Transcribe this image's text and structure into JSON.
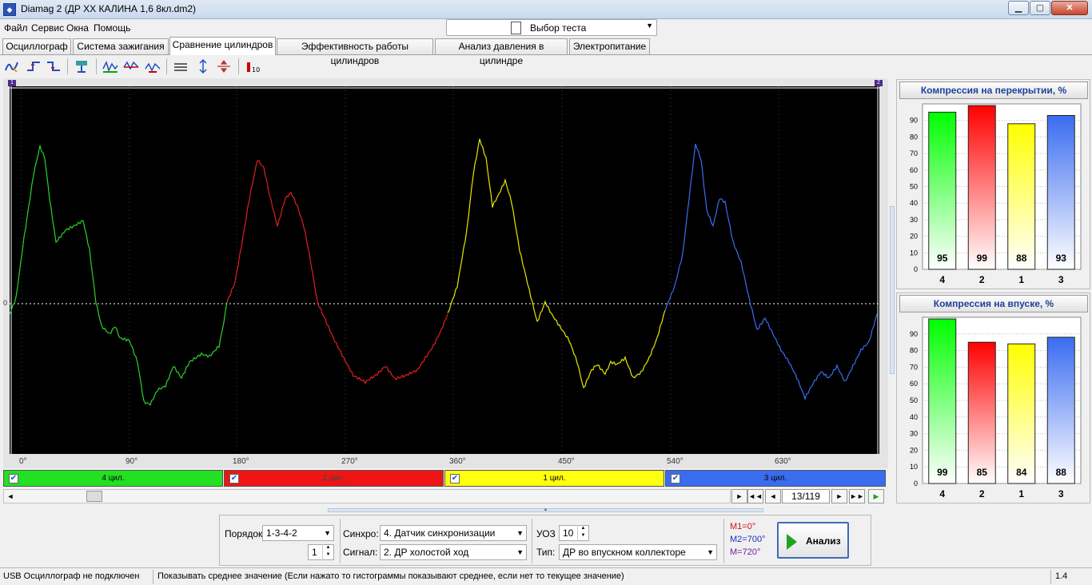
{
  "window": {
    "title": "Diamag 2 (ДР ХХ КАЛИНА 1,6 8кл.dm2)",
    "minimize": "▁",
    "maximize": "▢",
    "close": "✕"
  },
  "menu": [
    "Файл",
    "Сервис",
    "Окна",
    "Помощь"
  ],
  "test_select": {
    "label": "Выбор теста",
    "icon": "document-gear-icon"
  },
  "tabs": [
    {
      "label": "Осциллограф",
      "active": false
    },
    {
      "label": "Система зажигания",
      "active": false
    },
    {
      "label": "Сравнение цилиндров",
      "active": true
    },
    {
      "label": "Эффективность работы цилиндров",
      "active": false
    },
    {
      "label": "Анализ давления в цилиндре",
      "active": false
    },
    {
      "label": "Электропитание",
      "active": false
    }
  ],
  "toolbar": {
    "icons": [
      "cursor-wave-icon",
      "rising-edge-icon",
      "falling-edge-icon",
      "signal-probe-icon",
      "cylinder-split-icon",
      "cylinder-overlay-icon",
      "cylinder-shift-icon",
      "horizontal-lines-icon",
      "vertical-scale-icon",
      "center-icon",
      "bar-chart-icon"
    ]
  },
  "scope": {
    "marker_left": "1",
    "marker_right": "2",
    "zero_label": "0",
    "degree_labels": [
      "0°",
      "90°",
      "180°",
      "270°",
      "360°",
      "450°",
      "540°",
      "630°"
    ],
    "colors": {
      "background": "#000000",
      "grid": "#3c3c3c",
      "baseline": "#ffffff"
    }
  },
  "cylinders": [
    {
      "label": "4 цил.",
      "color": "#00ff00",
      "checked": true
    },
    {
      "label": "2 цил.",
      "color": "#ff0000",
      "checked": true
    },
    {
      "label": "1 цил.",
      "color": "#ffff00",
      "checked": true
    },
    {
      "label": "3 цил.",
      "color": "#3a6cf0",
      "checked": true
    }
  ],
  "navigation": {
    "counter": "13/119",
    "scroll_left": "◄",
    "scroll_right": "►",
    "first": "◄◄",
    "prev": "◄",
    "next": "►",
    "last": "►►",
    "play": "▶",
    "step": "►"
  },
  "charts": [
    {
      "title": "Компрессия на перекрытии, %",
      "ylim": [
        0,
        100
      ],
      "yticks": [
        "0",
        "10",
        "20",
        "30",
        "40",
        "50",
        "60",
        "70",
        "80",
        "90"
      ],
      "bars": [
        {
          "cyl": "4",
          "value": 95,
          "label": "95",
          "color": "#00ff00"
        },
        {
          "cyl": "2",
          "value": 99,
          "label": "99",
          "color": "#ff0000"
        },
        {
          "cyl": "1",
          "value": 88,
          "label": "88",
          "color": "#ffff00"
        },
        {
          "cyl": "3",
          "value": 93,
          "label": "93",
          "color": "#3a6cf0"
        }
      ]
    },
    {
      "title": "Компрессия на впуске, %",
      "ylim": [
        0,
        100
      ],
      "yticks": [
        "0",
        "10",
        "20",
        "30",
        "40",
        "50",
        "60",
        "70",
        "80",
        "90"
      ],
      "bars": [
        {
          "cyl": "4",
          "value": 99,
          "label": "99",
          "color": "#00ff00"
        },
        {
          "cyl": "2",
          "value": 85,
          "label": "85",
          "color": "#ff0000"
        },
        {
          "cyl": "1",
          "value": 84,
          "label": "84",
          "color": "#ffff00"
        },
        {
          "cyl": "3",
          "value": 88,
          "label": "88",
          "color": "#3a6cf0"
        }
      ]
    }
  ],
  "chart_data": [
    {
      "type": "bar",
      "title": "Компрессия на перекрытии, %",
      "categories": [
        "4",
        "2",
        "1",
        "3"
      ],
      "values": [
        95,
        99,
        88,
        93
      ],
      "ylim": [
        0,
        100
      ],
      "grid": true
    },
    {
      "type": "bar",
      "title": "Компрессия на впуске, %",
      "categories": [
        "4",
        "2",
        "1",
        "3"
      ],
      "values": [
        99,
        85,
        84,
        88
      ],
      "ylim": [
        0,
        100
      ],
      "grid": true
    }
  ],
  "controls": {
    "order_label": "Порядок",
    "order_value": "1-3-4-2",
    "order_spin_value": "1",
    "sync_label": "Синхро:",
    "sync_value": "4.  Датчик синхронизации",
    "signal_label": "Сигнал:",
    "signal_value": "2.  ДР холостой ход",
    "uoz_label": "УОЗ",
    "uoz_value": "10",
    "type_label": "Тип:",
    "type_value": "ДР во впускном коллекторе",
    "m1": "M1=0°",
    "m2": "M2=700°",
    "m3": "M=720°",
    "analyze_label": "Анализ"
  },
  "status": {
    "usb": "USB Осциллограф не подключен",
    "hint": "Показывать среднее значение (Если нажато то гистограммы показывают среднее, если нет то текущее значение)",
    "version": "1.4"
  }
}
